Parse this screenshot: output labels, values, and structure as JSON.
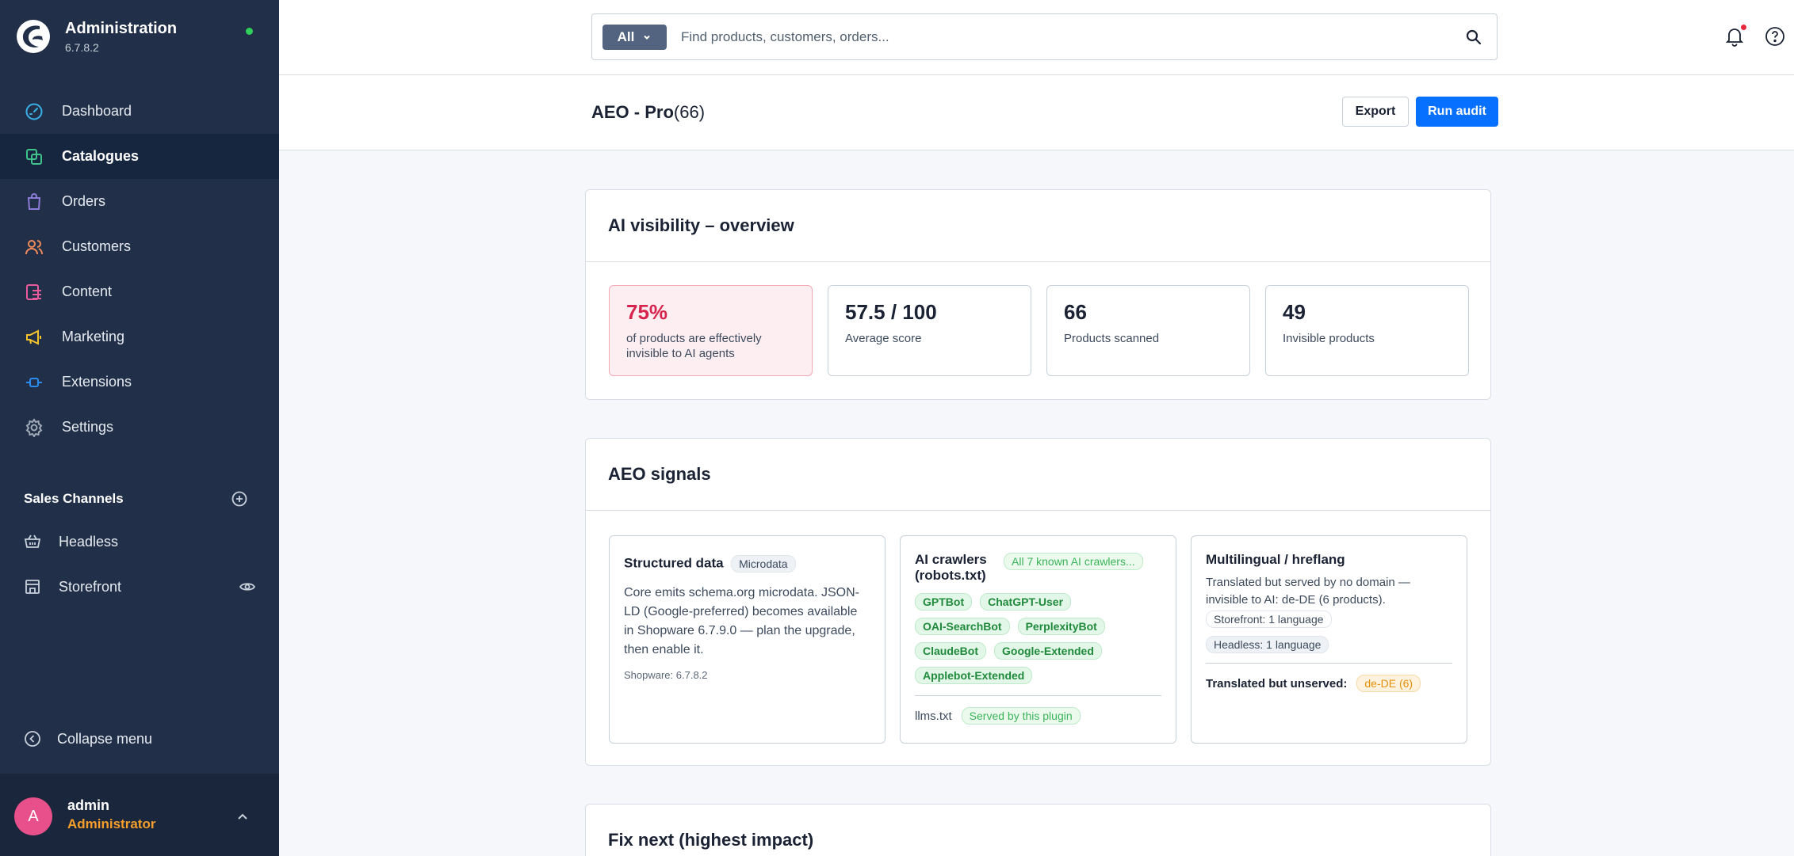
{
  "app": {
    "title": "Administration",
    "version": "6.7.8.2"
  },
  "nav": {
    "items": [
      {
        "label": "Dashboard",
        "icon": "gauge-icon",
        "color": "#3ab0e8"
      },
      {
        "label": "Catalogues",
        "icon": "catalog-icon",
        "color": "#3fc28c",
        "active": true
      },
      {
        "label": "Orders",
        "icon": "bag-icon",
        "color": "#8c7bd9"
      },
      {
        "label": "Customers",
        "icon": "users-icon",
        "color": "#f08a5a"
      },
      {
        "label": "Content",
        "icon": "content-icon",
        "color": "#e85b9c"
      },
      {
        "label": "Marketing",
        "icon": "megaphone-icon",
        "color": "#f5c32b"
      },
      {
        "label": "Extensions",
        "icon": "plug-icon",
        "color": "#2b8cf0"
      },
      {
        "label": "Settings",
        "icon": "gear-icon",
        "color": "#a0aab8"
      }
    ]
  },
  "sales_channels": {
    "title": "Sales Channels",
    "items": [
      {
        "label": "Headless",
        "icon": "basket-icon"
      },
      {
        "label": "Storefront",
        "icon": "store-icon"
      }
    ]
  },
  "sidebar_footer": {
    "collapse_label": "Collapse menu",
    "user_initial": "A",
    "user_name": "admin",
    "user_role": "Administrator"
  },
  "search": {
    "scope": "All",
    "placeholder": "Find products, customers, orders..."
  },
  "page": {
    "title": "AEO - Pro",
    "count": "(66)",
    "export_label": "Export",
    "run_label": "Run audit"
  },
  "overview": {
    "title": "AI visibility – overview",
    "kpis": [
      {
        "value": "75%",
        "label": "of products are effectively invisible to AI agents"
      },
      {
        "value": "57.5 / 100",
        "label": "Average score"
      },
      {
        "value": "66",
        "label": "Products scanned"
      },
      {
        "value": "49",
        "label": "Invisible products"
      }
    ]
  },
  "signals": {
    "title": "AEO signals",
    "structured": {
      "title": "Structured data",
      "badge": "Microdata",
      "text": "Core emits schema.org microdata. JSON-LD (Google-preferred) becomes available in Shopware 6.7.9.0 — plan the upgrade, then enable it.",
      "meta": "Shopware: 6.7.8.2"
    },
    "crawlers": {
      "title": "AI crawlers (robots.txt)",
      "badge": "All 7 known AI crawlers...",
      "bots": [
        "GPTBot",
        "ChatGPT-User",
        "OAI-SearchBot",
        "PerplexityBot",
        "ClaudeBot",
        "Google-Extended",
        "Applebot-Extended"
      ],
      "llms_label": "llms.txt",
      "llms_badge": "Served by this plugin"
    },
    "multilingual": {
      "title": "Multilingual / hreflang",
      "text": "Translated but served by no domain — invisible to AI: de-DE (6 products).",
      "storefront_lang": "Storefront: 1 language",
      "headless_lang": "Headless: 1 language",
      "unserved_label": "Translated but unserved:",
      "unserved_badge": "de-DE (6)"
    }
  },
  "fixnext": {
    "title": "Fix next (highest impact)"
  }
}
